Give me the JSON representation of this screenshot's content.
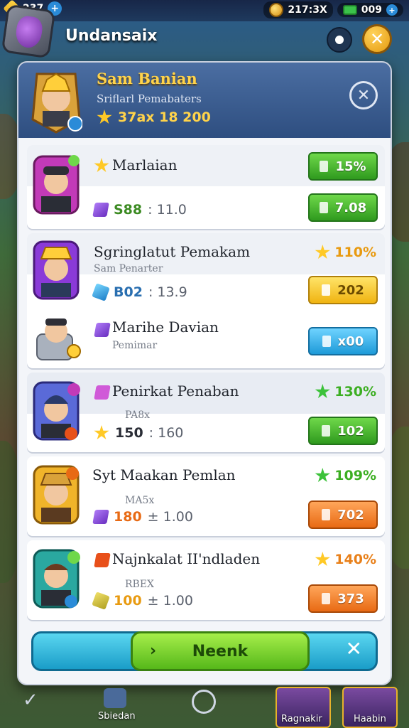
{
  "hud": {
    "level": "237",
    "coins": "217:3X",
    "cash": "009"
  },
  "header": {
    "title": "Undansaix"
  },
  "panel_header": {
    "name": "Sam Banian",
    "subtitle": "Sriflarl Pemabaters",
    "score": "37ax 18 200"
  },
  "rows": [
    {
      "name": "Marlaian",
      "subtitle": "",
      "stat_value": "S88",
      "stat_rest": ": 11.0",
      "percent": "15%",
      "button_label": "7.08",
      "button_color": "#3ac12a"
    },
    {
      "name": "Sgringlatut Pemakam",
      "subtitle": "Sam Penarter",
      "stat_value": "B02",
      "stat_rest": ": 13.9",
      "percent": "110%",
      "button_label": "202",
      "button_color": "#f0b412"
    },
    {
      "name": "Marihe Davian",
      "subtitle": "Pemimar",
      "stat_value": "",
      "stat_rest": "",
      "percent": "",
      "button_label": "x00",
      "button_color": "#1d9ad8"
    },
    {
      "name": "Penirkat Penaban",
      "subtitle": "PA8x",
      "stat_value": "150",
      "stat_rest": ": 160",
      "percent": "130%",
      "button_label": "102",
      "button_color": "#3ac12a"
    },
    {
      "name": "Syt Maakan Pemlan",
      "subtitle": "MA5x",
      "stat_value": "180",
      "stat_rest": "± 1.00",
      "percent": "109%",
      "button_label": "702",
      "button_color": "#e86a14"
    },
    {
      "name": "Najnkalat II'ndladen",
      "subtitle": "RBEX",
      "stat_value": "100",
      "stat_rest": "± 1.00",
      "percent": "140%",
      "button_label": "373",
      "button_color": "#e86a14"
    }
  ],
  "action": {
    "next_label": "Neenk"
  },
  "bottom_nav": {
    "left_label": "Sbiedan",
    "card1_label": "Ragnakir",
    "card2_label": "Haabin"
  }
}
